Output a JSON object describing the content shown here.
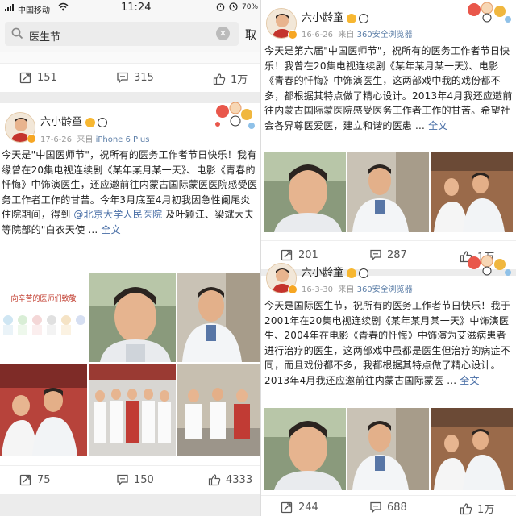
{
  "status_bar": {
    "carrier": "中国移动",
    "time": "11:24",
    "battery": "70%"
  },
  "search": {
    "query": "医生节",
    "cancel_label": "取"
  },
  "left_column": {
    "prev_actions": {
      "reposts": "151",
      "comments": "315",
      "likes": "1万"
    },
    "post": {
      "username": "六小龄童",
      "date": "17-6-26",
      "source_prefix": "来自",
      "device": "iPhone 6 Plus",
      "text": "今天是\"中国医师节\"，祝所有的医务工作者节日快乐！我有缘曾在20集电视连续剧《某年某月某一天》、电影《青春的忏悔》中饰演医生，还应邀前往内蒙古国际蒙医医院感受医务工作者工作的甘苦。今年3月底至4月初我因急性阑尾炎住院期间，得到 ",
      "mention": "@北京大学人民医院",
      "text_tail": " 及叶颖江、梁斌大夫等院部的\"白衣天使 ... ",
      "more_label": "全文",
      "banner_text": "向辛苦的医师们致敬",
      "actions": {
        "reposts": "75",
        "comments": "150",
        "likes": "4333"
      }
    }
  },
  "right_column": {
    "post1": {
      "username": "六小龄童",
      "date": "16-6-26",
      "source_prefix": "来自",
      "device": "360安全浏览器",
      "text": "今天是第六届\"中国医师节\"，祝所有的医务工作者节日快乐！我曾在20集电视连续剧《某年某月某一天》、电影《青春的忏悔》中饰演医生，这两部戏中我的戏份都不多，都根据其特点做了精心设计。2013年4月我还应邀前往内蒙古国际蒙医院感受医务工作者工作的甘苦。希望社会各界尊医爱医，建立和谐的医患 ... ",
      "more_label": "全文",
      "actions": {
        "reposts": "201",
        "comments": "287",
        "likes": "1万"
      }
    },
    "post2": {
      "username": "六小龄童",
      "date": "16-3-30",
      "source_prefix": "来自",
      "device": "360安全浏览器",
      "text": "今天是国际医生节，祝所有的医务工作者节日快乐！我于2001年在20集电视连续剧《某年某月某一天》中饰演医生、2004年在电影《青春的忏悔》中饰演为艾滋病患者进行治疗的医生，这两部戏中虽都是医生但治疗的病症不同，而且戏份都不多，我都根据其特点做了精心设计。2013年4月我还应邀前往内蒙古国际蒙医 ... ",
      "more_label": "全文",
      "actions": {
        "reposts": "244",
        "comments": "688",
        "likes": "1万"
      }
    }
  },
  "colors": {
    "link": "#486ea6",
    "badge": "#f6a623",
    "separator": "#ececec"
  },
  "icons": [
    "search-icon",
    "clear-icon",
    "repost-icon",
    "comment-icon",
    "like-icon",
    "verified-badge-icon",
    "panda-icon",
    "cartoon-sticker-icon"
  ]
}
